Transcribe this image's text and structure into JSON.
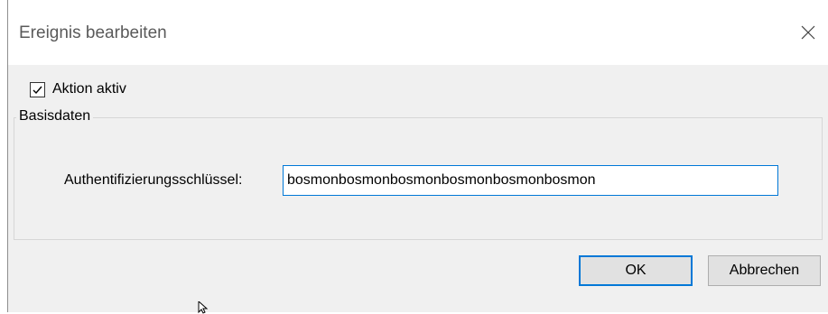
{
  "window": {
    "title": "Ereignis bearbeiten",
    "close_icon": "close-icon"
  },
  "options": {
    "action_active_label": "Aktion aktiv",
    "action_active_checked": true
  },
  "basisdaten": {
    "legend": "Basisdaten",
    "auth_key_label": "Authentifizierungsschlüssel:",
    "auth_key_value": "bosmonbosmonbosmonbosmonbosmonbosmon"
  },
  "buttons": {
    "ok_label": "OK",
    "cancel_label": "Abbrechen"
  },
  "colors": {
    "accent": "#0078d7",
    "dialog_bg": "#f0f0f0",
    "titlebar_bg": "#ffffff"
  }
}
